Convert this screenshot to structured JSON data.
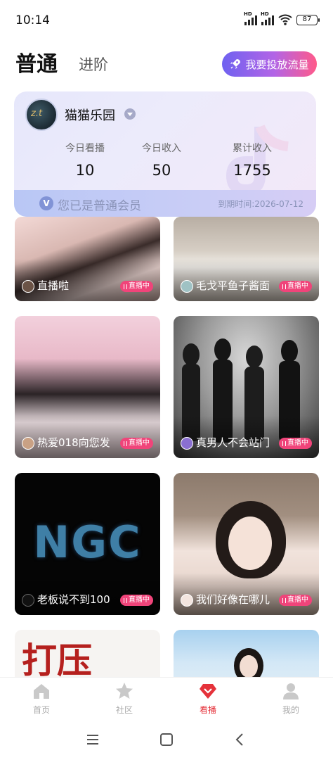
{
  "status_bar": {
    "time": "10:14",
    "battery": "87",
    "hd1": "HD",
    "hd2": "HD"
  },
  "header": {
    "tab_normal": "普通",
    "tab_advanced": "进阶",
    "promo_button": "我要投放流量"
  },
  "card": {
    "user_name": "猫猫乐园",
    "avatar_text": "z.t",
    "stats": [
      {
        "label": "今日看播",
        "value": "10"
      },
      {
        "label": "今日收入",
        "value": "50"
      },
      {
        "label": "累计收入",
        "value": "1755"
      }
    ],
    "member_badge": "V",
    "member_text": "您已是普通会员",
    "expiry": "到期时间:2026-07-12"
  },
  "feed": {
    "live_label": "直播中",
    "tiles": [
      {
        "title": "直播啦"
      },
      {
        "title": "毛戈平鱼子酱面"
      },
      {
        "title": "热爱018向您发"
      },
      {
        "title": "真男人不会站门"
      },
      {
        "title": "老板说不到100"
      },
      {
        "title": "我们好像在哪儿"
      },
      {
        "title": ""
      },
      {
        "title": ""
      }
    ],
    "ngc_text": "NGC",
    "poster_text": "打压"
  },
  "bottom_nav": {
    "items": [
      {
        "label": "首页",
        "icon": "home-icon"
      },
      {
        "label": "社区",
        "icon": "star-icon"
      },
      {
        "label": "看播",
        "icon": "gem-icon",
        "active": true
      },
      {
        "label": "我的",
        "icon": "person-icon"
      }
    ]
  },
  "colors": {
    "accent": "#e5323b",
    "live": "#f0447a",
    "promo_start": "#6f62f0",
    "promo_end": "#ff5a8a"
  }
}
